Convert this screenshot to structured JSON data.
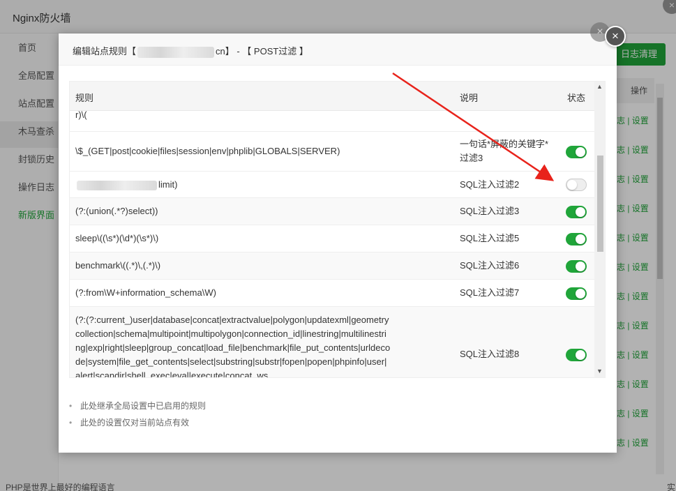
{
  "app": {
    "title": "Nginx防火墙",
    "sidebar": [
      "首页",
      "全局配置",
      "站点配置",
      "木马查杀",
      "封锁历史",
      "操作日志",
      "新版界面"
    ],
    "clear_log_button": "日志清理",
    "op_column": "操作",
    "op_links": "志 | 设置",
    "footer_text": "PHP是世界上最好的编程语言",
    "footer_right": "实"
  },
  "modal": {
    "title_prefix": "编辑站点规则【",
    "title_suffix": "cn】 - 【 POST过滤 】",
    "close_icon": "×",
    "columns": {
      "rule": "规则",
      "desc": "说明",
      "status": "状态"
    },
    "rows": [
      {
        "rule": "r)\\(",
        "desc": "",
        "status": null
      },
      {
        "rule": "\\$_(GET|post|cookie|files|session|env|phplib|GLOBALS|SERVER)",
        "desc": "一句话*屏蔽的关键字*过滤3",
        "status": true
      },
      {
        "rule": "limit)",
        "desc": "SQL注入过滤2",
        "status": false
      },
      {
        "rule": "(?:(union(.*?)select))",
        "desc": "SQL注入过滤3",
        "status": true
      },
      {
        "rule": "sleep\\((\\s*)(\\d*)(\\s*)\\)",
        "desc": "SQL注入过滤5",
        "status": true
      },
      {
        "rule": "benchmark\\((.*)\\,(.*)\\)",
        "desc": "SQL注入过滤6",
        "status": true
      },
      {
        "rule": "(?:from\\W+information_schema\\W)",
        "desc": "SQL注入过滤7",
        "status": true
      },
      {
        "rule": "(?:(?:current_)user|database|concat|extractvalue|polygon|updatexml|geometrycollection|schema|multipoint|multipolygon|connection_id|linestring|multilinestring|exp|right|sleep|group_concat|load_file|benchmark|file_put_contents|urldecode|system|file_get_contents|select|substring|substr|fopen|popen|phpinfo|user|alert|scandir|shell_exec|eval|execute|concat_ws",
        "desc": "SQL注入过滤8",
        "status": true
      }
    ],
    "notes": [
      "此处继承全局设置中已启用的规则",
      "此处的设置仅对当前站点有效"
    ]
  },
  "colors": {
    "accent": "#20a53a",
    "arrow": "#e8231b"
  }
}
